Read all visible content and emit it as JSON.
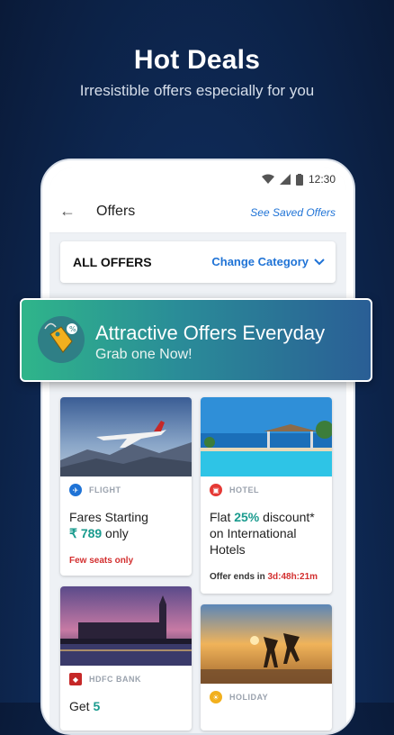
{
  "hero": {
    "title": "Hot Deals",
    "subtitle": "Irresistible offers especially for you"
  },
  "status_bar": {
    "time": "12:30"
  },
  "app_bar": {
    "title": "Offers",
    "saved_link": "See Saved Offers"
  },
  "filter": {
    "label": "ALL OFFERS",
    "change_label": "Change Category"
  },
  "banner": {
    "title": "Attractive Offers Everyday",
    "subtitle": "Grab one Now!"
  },
  "cards": [
    {
      "category": "FLIGHT",
      "title_line1": "Fares Starting",
      "title_currency": "₹",
      "title_amount": "789",
      "title_suffix": " only",
      "note": "Few seats only"
    },
    {
      "category": "HOTEL",
      "title_prefix": "Flat ",
      "title_highlight": "25%",
      "title_rest": " discount* on International Hotels",
      "note_prefix": "Offer ends in ",
      "note_timer": "3d:48h:21m"
    },
    {
      "category": "HDFC BANK",
      "title_prefix": "Get ",
      "title_highlight": "5"
    },
    {
      "category": "HOLIDAY"
    }
  ],
  "colors": {
    "accent": "#1f73d6",
    "teal": "#1a9b8e",
    "alert_red": "#d32f2f",
    "banner_start": "#2fb58a",
    "banner_end": "#2a5e95"
  }
}
